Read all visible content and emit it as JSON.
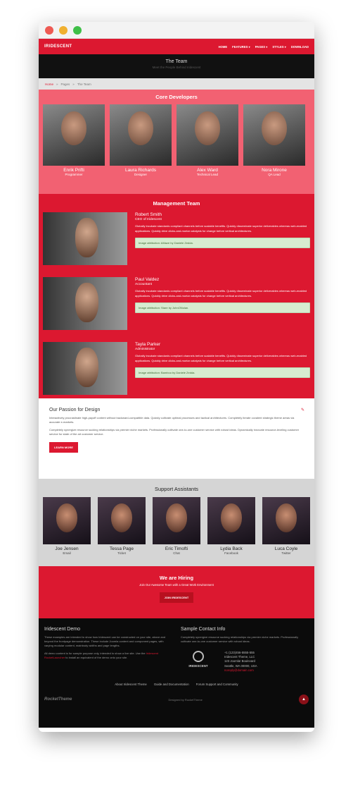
{
  "nav": {
    "logo": "IRIDESCENT",
    "items": [
      "HOME",
      "FEATURES ▾",
      "PAGES ▾",
      "STYLES ▾",
      "DOWNLOAD"
    ]
  },
  "hero": {
    "title": "The Team",
    "subtitle": "Meet the People Behind Iridescent"
  },
  "breadcrumb": {
    "home": "Home",
    "sep": "»",
    "pages": "Pages",
    "current": "The Team"
  },
  "core": {
    "title": "Core Developers",
    "members": [
      {
        "name": "Enrik Prifti",
        "role": "Programmer"
      },
      {
        "name": "Laura Richards",
        "role": "Designer"
      },
      {
        "name": "Alex Ward",
        "role": "Technical Lead"
      },
      {
        "name": "Nora Mirone",
        "role": "QA Lead"
      }
    ]
  },
  "management": {
    "title": "Management Team",
    "members": [
      {
        "name": "Robert Smith",
        "role": "CEO of Iridescent",
        "desc": "Globally incubate standards compliant channels before scalable benefits. Quickly disseminate superior deliverables whereas web-enabled applications. Quickly drive clicks-and-mortar catalysts for change before vertical architectures.",
        "attr": "Image attribution: AMaze by Daniele Zedda."
      },
      {
        "name": "Paul Valdez",
        "role": "Accountant",
        "desc": "Globally incubate standards compliant channels before scalable benefits. Quickly disseminate superior deliverables whereas web-enabled applications. Quickly drive clicks-and-mortar catalysts for change before vertical architectures.",
        "attr": "Image attribution: Stare by JohnONolan."
      },
      {
        "name": "Tayla Parker",
        "role": "Administrator",
        "desc": "Globally incubate standards compliant channels before scalable benefits. Quickly disseminate superior deliverables whereas web-enabled applications. Quickly drive clicks-and-mortar catalysts for change before vertical architectures.",
        "attr": "Image attribution: Bamboo by Daniele Zedda."
      }
    ]
  },
  "passion": {
    "title": "Our Passion for Design",
    "p1": "Interactively procrastinate high-payoff content without backward-compatible data. Quickly cultivate optimal processes and tactical architectures. Completely iterate covalent strategic theme areas via accurate e-markets.",
    "p2": "Completely synergize resource sucking relationships via premier niche markets. Professionally cultivate one-to-one customer service with robust ideas. Dynamically innovate resource-leveling customer service for state of the art customer service.",
    "button": "LEARN MORE"
  },
  "support": {
    "title": "Support Assistants",
    "members": [
      {
        "name": "Joe Jensen",
        "role": "Email"
      },
      {
        "name": "Tessa Page",
        "role": "Ticket"
      },
      {
        "name": "Eric Timofti",
        "role": "Chat"
      },
      {
        "name": "Lydia Back",
        "role": "Facebook"
      },
      {
        "name": "Luca Coyle",
        "role": "Twitter"
      }
    ]
  },
  "hiring": {
    "title": "We are Hiring",
    "subtitle": "Join Our Awesome Team with a Great Work Environment",
    "button": "JOIN IRIDESCENT"
  },
  "footer": {
    "demo_title": "Iridescent Demo",
    "demo_p1": "These examples are intended to show how Iridescent can be constructed on your site, above and beyond the frontpage demonstration. These include Joomla content and component pages, with varying modular content, mainbody widths and page lengths.",
    "demo_p2a": "All demo content is for sample purpose only, intended to show a live site. Use the",
    "demo_link": "Iridescent RocketLauncher",
    "demo_p2b": "to install an equivalent of the demo onto your site.",
    "contact_title": "Sample Contact Info",
    "contact_p": "Completely synergize resource sucking relationships via premier niche markets. Professionally cultivate one-to-one customer service with robust ideas.",
    "emblem": "IRIDESCENT",
    "phone": "+1 (123)456-5555-555",
    "company": "Iridescent Theme, LLC",
    "street": "123 Joomla! Boulevard",
    "city": "Seattle, WA 00000, USA",
    "email": "noreply@domain.com",
    "links": [
      "About Iridescent Theme",
      "Guide and Documentation",
      "Forum Support and Community"
    ],
    "brand": "RocketTheme",
    "designed": "Designed by RocketTheme",
    "up": "▲"
  }
}
